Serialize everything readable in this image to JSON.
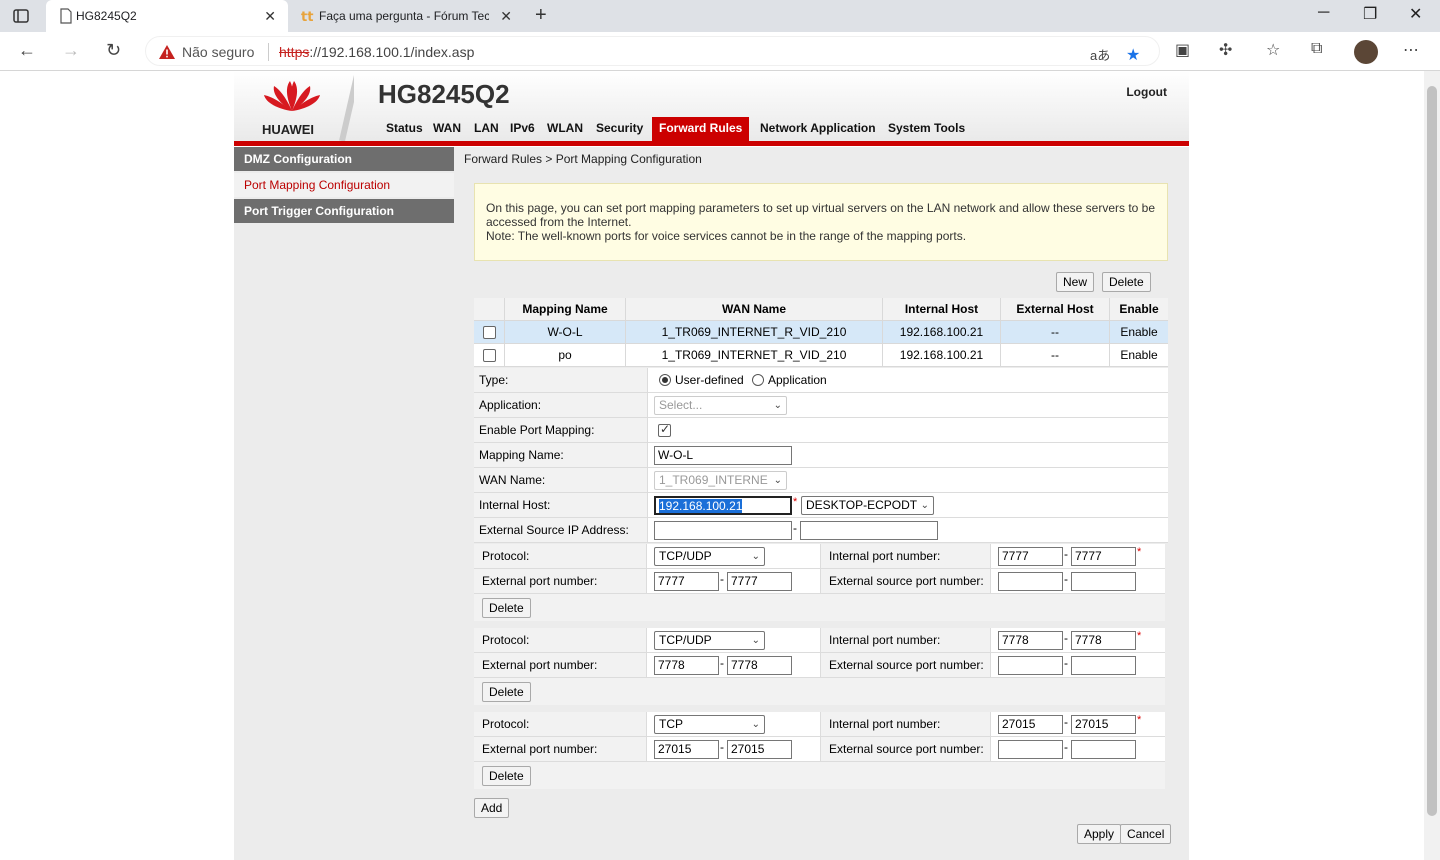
{
  "browser": {
    "tabs": [
      {
        "title": "HG8245Q2",
        "active": true
      },
      {
        "title": "Faça uma pergunta - Fórum Tech",
        "active": false
      }
    ],
    "security_label": "Não seguro",
    "url_scheme": "https",
    "url_rest": "://192.168.100.1/index.asp"
  },
  "router": {
    "brand": "HUAWEI",
    "model": "HG8245Q2",
    "logout": "Logout",
    "nav": [
      "Status",
      "WAN",
      "LAN",
      "IPv6",
      "WLAN",
      "Security",
      "Forward Rules",
      "Network Application",
      "System Tools"
    ],
    "active_nav": "Forward Rules",
    "sidebar": [
      "DMZ Configuration",
      "Port Mapping Configuration",
      "Port Trigger Configuration"
    ],
    "breadcrumb": "Forward Rules > Port Mapping Configuration",
    "info_line1": "On this page, you can set port mapping parameters to set up virtual servers on the LAN network and allow these servers to be accessed from the Internet.",
    "info_line2": "Note: The well-known ports for voice services cannot be in the range of the mapping ports.",
    "buttons": {
      "new": "New",
      "delete": "Delete",
      "add": "Add",
      "apply": "Apply",
      "cancel": "Cancel",
      "row_delete": "Delete"
    },
    "table": {
      "headers": [
        "Mapping Name",
        "WAN Name",
        "Internal Host",
        "External Host",
        "Enable"
      ],
      "rows": [
        {
          "name": "W-O-L",
          "wan": "1_TR069_INTERNET_R_VID_210",
          "internal": "192.168.100.21",
          "external": "--",
          "enable": "Enable"
        },
        {
          "name": "po",
          "wan": "1_TR069_INTERNET_R_VID_210",
          "internal": "192.168.100.21",
          "external": "--",
          "enable": "Enable"
        }
      ]
    },
    "form": {
      "type_label": "Type:",
      "type_user": "User-defined",
      "type_app": "Application",
      "application_label": "Application:",
      "application_value": "Select...",
      "enable_label": "Enable Port Mapping:",
      "mapping_name_label": "Mapping Name:",
      "mapping_name_value": "W-O-L",
      "wan_name_label": "WAN Name:",
      "wan_name_value": "1_TR069_INTERNE",
      "internal_host_label": "Internal Host:",
      "internal_host_value": "192.168.100.21",
      "internal_host_device": "DESKTOP-ECPODT",
      "ext_src_ip_label": "External Source IP Address:"
    },
    "port_labels": {
      "protocol": "Protocol:",
      "internal_port": "Internal port number:",
      "external_port": "External port number:",
      "external_src_port": "External source port number:"
    },
    "port_rules": [
      {
        "protocol": "TCP/UDP",
        "int_start": "7777",
        "int_end": "7777",
        "ext_start": "7777",
        "ext_end": "7777"
      },
      {
        "protocol": "TCP/UDP",
        "int_start": "7778",
        "int_end": "7778",
        "ext_start": "7778",
        "ext_end": "7778"
      },
      {
        "protocol": "TCP",
        "int_start": "27015",
        "int_end": "27015",
        "ext_start": "27015",
        "ext_end": "27015"
      }
    ]
  }
}
